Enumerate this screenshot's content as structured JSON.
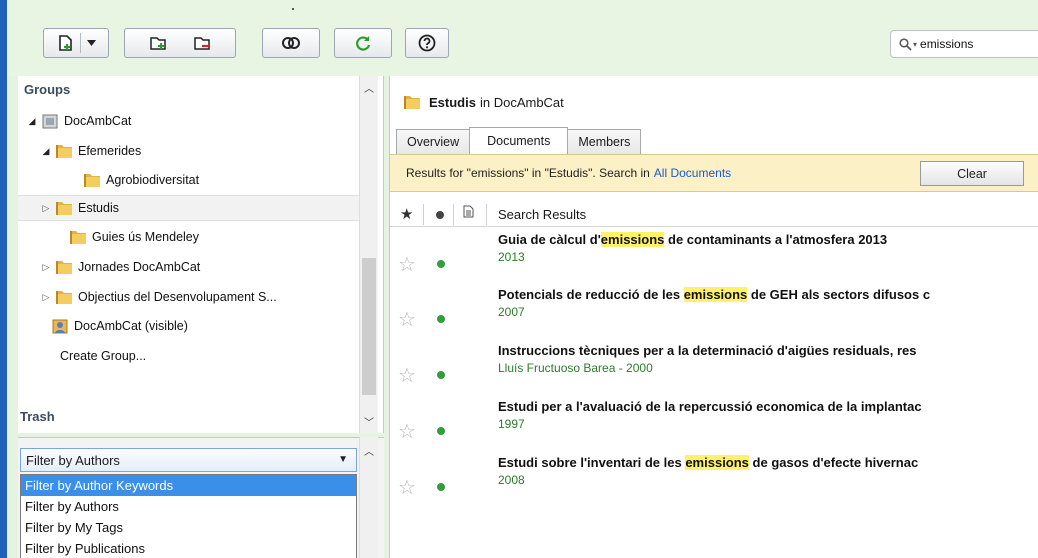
{
  "toolbar": {
    "buttons": [
      "add-document",
      "dropdown",
      "add-folder",
      "remove-folder",
      "merge",
      "sync",
      "help"
    ],
    "search_value": "emissions"
  },
  "groups_panel": {
    "heading": "Groups",
    "trash": "Trash",
    "tree": [
      {
        "label": "DocAmbCat",
        "arrow": "open",
        "icon": "group-icon"
      },
      {
        "label": "Efemerides",
        "arrow": "open",
        "icon": "folder-icon"
      },
      {
        "label": "Agrobiodiversitat",
        "arrow": "",
        "icon": "folder-icon"
      },
      {
        "label": "Estudis",
        "arrow": "closed",
        "icon": "folder-icon",
        "selected": true
      },
      {
        "label": "Guies ús Mendeley",
        "arrow": "",
        "icon": "folder-icon"
      },
      {
        "label": "Jornades DocAmbCat",
        "arrow": "closed",
        "icon": "folder-icon"
      },
      {
        "label": "Objectius del Desenvolupament S...",
        "arrow": "closed",
        "icon": "folder-icon"
      },
      {
        "label": "DocAmbCat (visible)",
        "arrow": "",
        "icon": "public-group-icon"
      },
      {
        "label": "Create Group...",
        "arrow": "",
        "icon": ""
      }
    ]
  },
  "filter": {
    "selected": "Filter by Authors",
    "options": [
      "Filter by Author Keywords",
      "Filter by Authors",
      "Filter by My Tags",
      "Filter by Publications"
    ],
    "highlighted_index": 0
  },
  "main": {
    "crumb_folder": "Estudis",
    "crumb_in": "in DocAmbCat",
    "tabs": [
      "Overview",
      "Documents",
      "Members"
    ],
    "active_tab": 1,
    "results_text": "Results for \"emissions\" in \"Estudis\". Search in",
    "results_link": "All Documents",
    "clear_label": "Clear",
    "column_label": "Search Results",
    "rows": [
      {
        "pre": "Guia de càlcul d'",
        "hl": "emissions",
        "post": " de contaminants a l'atmosfera 2013",
        "meta": "2013"
      },
      {
        "pre": "Potencials de reducció de les ",
        "hl": "emissions",
        "post": " de GEH als sectors difusos c",
        "meta": "2007"
      },
      {
        "pre": "Instruccions tècniques per a la determinació d'aigües residuals, res",
        "hl": "",
        "post": "",
        "meta": "Lluís Fructuoso Barea - 2000"
      },
      {
        "pre": "Estudi per a l'avaluació de la repercussió economica de la implantac",
        "hl": "",
        "post": "",
        "meta": "1997"
      },
      {
        "pre": "Estudi sobre l'inventari de les ",
        "hl": "emissions",
        "post": " de gasos d'efecte hivernac",
        "meta": "2008"
      }
    ]
  }
}
